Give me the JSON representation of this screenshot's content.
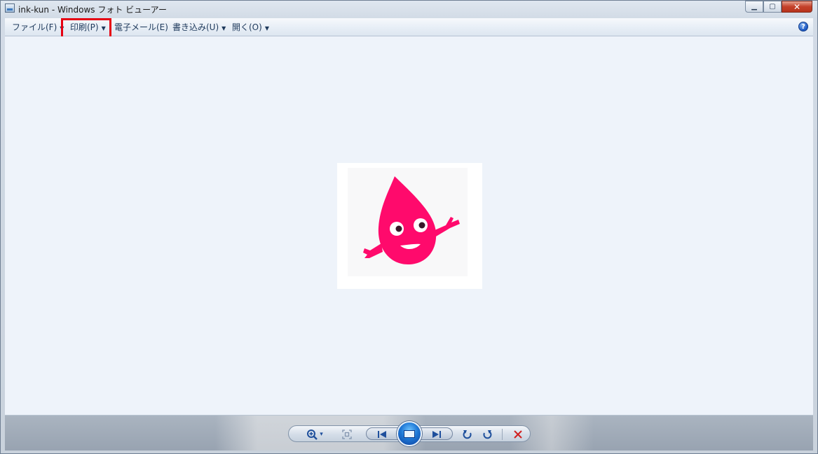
{
  "window": {
    "title": "ink-kun - Windows フォト ビューアー",
    "caption_buttons": {
      "minimize": "▁",
      "maximize": "▢",
      "close": "✕"
    }
  },
  "menubar": {
    "items": [
      {
        "label": "ファイル(F)",
        "has_dropdown": true
      },
      {
        "label": "印刷(P)",
        "has_dropdown": true
      },
      {
        "label": "電子メール(E)",
        "has_dropdown": false
      },
      {
        "label": "書き込み(U)",
        "has_dropdown": true
      },
      {
        "label": "開く(O)",
        "has_dropdown": true
      }
    ],
    "dropdown_arrow": "▼",
    "help_label": "?",
    "highlighted_item": "印刷(P)",
    "highlight_color": "#e60012"
  },
  "viewer": {
    "background": "#eef3fa",
    "image": {
      "subject": "ink-kun",
      "character_color": "#ff0a6c"
    }
  },
  "controls": {
    "zoom_icon": "magnifier-plus-icon",
    "zoom_arrow": "▾",
    "actual_size_icon": "actual-size-icon",
    "previous_icon": "skip-previous-icon",
    "slideshow_icon": "slideshow-icon",
    "next_icon": "skip-next-icon",
    "rotate_ccw_icon": "rotate-counterclockwise-icon",
    "rotate_cw_icon": "rotate-clockwise-icon",
    "delete_icon": "delete-icon",
    "accent_color": "#1e4f9c",
    "delete_color": "#d02020"
  }
}
